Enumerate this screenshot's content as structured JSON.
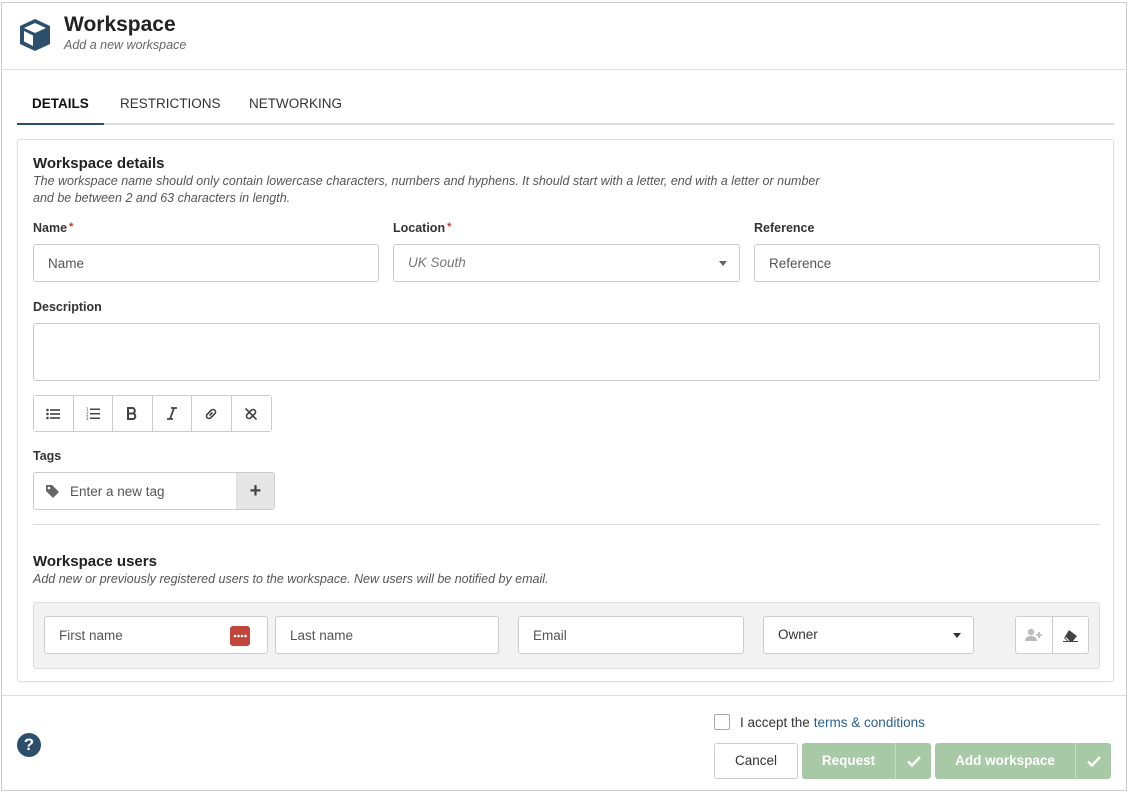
{
  "header": {
    "title": "Workspace",
    "subtitle": "Add a new workspace",
    "icon": "cube-icon"
  },
  "tabs": [
    {
      "label": "DETAILS",
      "active": true
    },
    {
      "label": "RESTRICTIONS",
      "active": false
    },
    {
      "label": "NETWORKING",
      "active": false
    }
  ],
  "details": {
    "title": "Workspace details",
    "help_line1": "The workspace name should only contain lowercase characters, numbers and hyphens. It should start with a letter, end with a letter or number",
    "help_line2": "and be between 2 and 63 characters in length.",
    "name_label": "Name",
    "name_placeholder": "Name",
    "location_label": "Location",
    "location_value": "UK South",
    "reference_label": "Reference",
    "reference_placeholder": "Reference",
    "required_marker": "*",
    "description_label": "Description",
    "description_value": "",
    "toolbar": [
      "bulleted-list-icon",
      "numbered-list-icon",
      "bold-icon",
      "italic-icon",
      "link-icon",
      "unlink-icon"
    ],
    "tags_label": "Tags",
    "tags_placeholder": "Enter a new tag",
    "tags_add": "+"
  },
  "users": {
    "title": "Workspace users",
    "help": "Add new or previously registered users to the workspace. New users will be notified by email.",
    "first_name_placeholder": "First name",
    "last_name_placeholder": "Last name",
    "email_placeholder": "Email",
    "role_value": "Owner"
  },
  "footer": {
    "help_icon": "?",
    "terms_prefix": "I accept the",
    "terms_link": "terms & conditions",
    "cancel_label": "Cancel",
    "request_label": "Request",
    "add_label": "Add workspace"
  },
  "colors": {
    "accent": "#2c4f6c",
    "green_disabled": "#a8c9a6",
    "required": "#c0392b",
    "key_button": "#c0453a"
  }
}
